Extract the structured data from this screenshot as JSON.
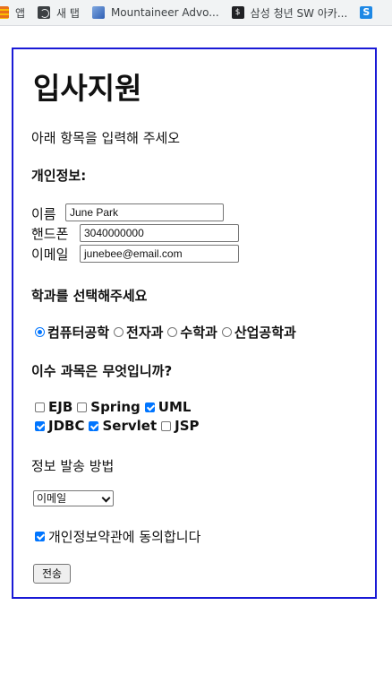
{
  "bookmarks": [
    {
      "label": "앱",
      "icon": "apps-icon"
    },
    {
      "label": "새 탭",
      "icon": "globe-icon"
    },
    {
      "label": "Mountaineer Advo...",
      "icon": "mountaineer-icon"
    },
    {
      "label": "삼성 청년 SW 아카...",
      "icon": "samsung-icon"
    },
    {
      "label": "",
      "icon": "s-icon"
    }
  ],
  "form": {
    "title": "입사지원",
    "subtitle": "아래 항목을 입력해 주세오",
    "personal_heading": "개인정보:",
    "name_label": "이름",
    "name_value": "June Park",
    "phone_label": "핸드폰",
    "phone_value": "3040000000",
    "email_label": "이메일",
    "email_value": "junebee@email.com",
    "dept_heading": "학과를 선택해주세요",
    "departments": [
      {
        "label": "컴퓨터공학",
        "selected": true
      },
      {
        "label": "전자과",
        "selected": false
      },
      {
        "label": "수학과",
        "selected": false
      },
      {
        "label": "산업공학과",
        "selected": false
      }
    ],
    "courses_heading": "이수 과목은 무엇입니까?",
    "courses": [
      {
        "label": "EJB",
        "checked": false
      },
      {
        "label": "Spring",
        "checked": false
      },
      {
        "label": "UML",
        "checked": true
      },
      {
        "label": "JDBC",
        "checked": true
      },
      {
        "label": "Servlet",
        "checked": true
      },
      {
        "label": "JSP",
        "checked": false
      }
    ],
    "delivery_heading": "정보 발송 방법",
    "delivery_selected": "이메일",
    "agree_label": "개인정보약관에 동의합니다",
    "agree_checked": true,
    "submit_label": "전송"
  },
  "colors": {
    "border": "#1a1ad6",
    "accent": "#0075ff"
  }
}
